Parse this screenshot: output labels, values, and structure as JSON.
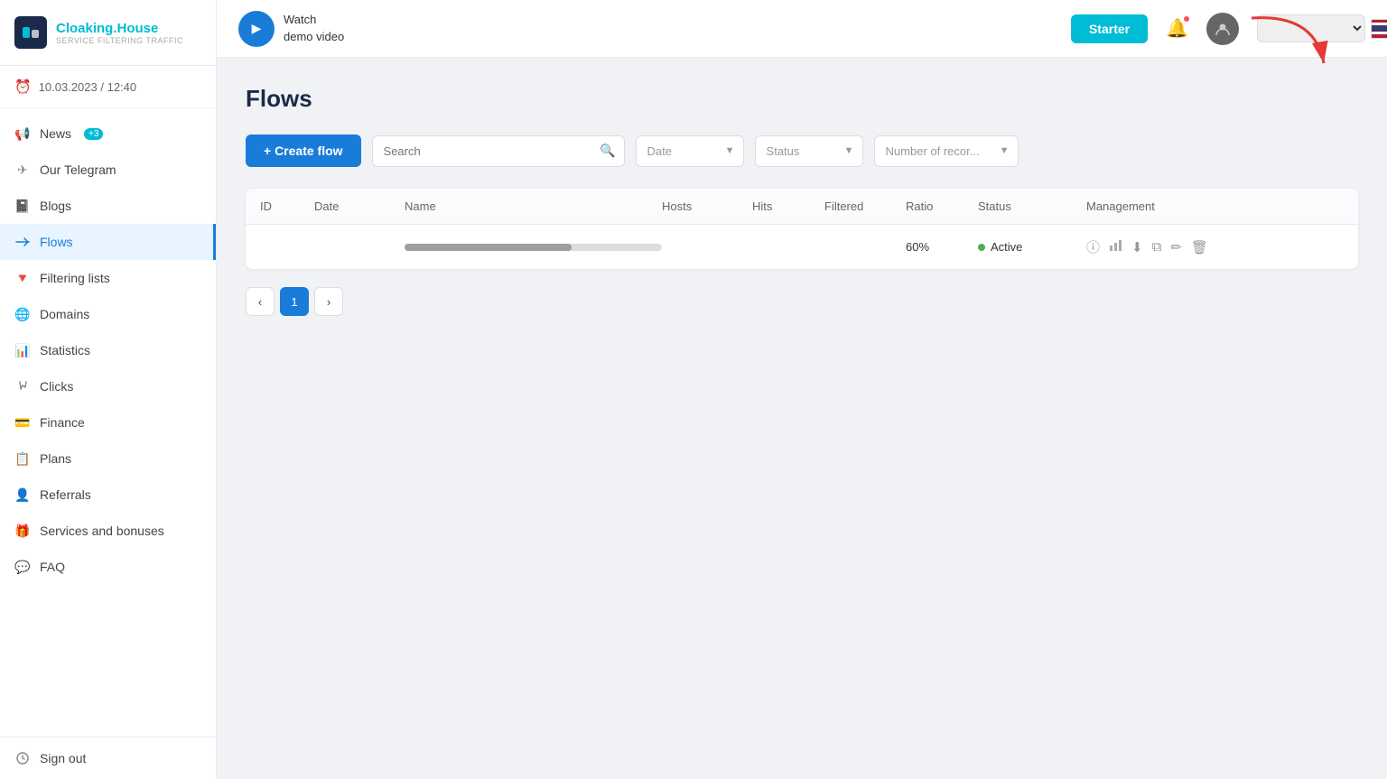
{
  "logo": {
    "icon_text": "C",
    "name": "Cloaking",
    "name_colored": ".House",
    "subtitle": "Service Filtering Traffic"
  },
  "sidebar": {
    "time": "10.03.2023 / 12:40",
    "items": [
      {
        "id": "news",
        "label": "News",
        "badge": "+3",
        "icon": "📢"
      },
      {
        "id": "telegram",
        "label": "Our Telegram",
        "icon": "✈"
      },
      {
        "id": "blogs",
        "label": "Blogs",
        "icon": "📓"
      },
      {
        "id": "flows",
        "label": "Flows",
        "icon": "↔",
        "active": true
      },
      {
        "id": "filtering-lists",
        "label": "Filtering lists",
        "icon": "🔻"
      },
      {
        "id": "domains",
        "label": "Domains",
        "icon": "🌐"
      },
      {
        "id": "statistics",
        "label": "Statistics",
        "icon": "📊"
      },
      {
        "id": "clicks",
        "label": "Clicks",
        "icon": "🖱"
      },
      {
        "id": "finance",
        "label": "Finance",
        "icon": "💳"
      },
      {
        "id": "plans",
        "label": "Plans",
        "icon": "📋"
      },
      {
        "id": "referrals",
        "label": "Referrals",
        "icon": "👤"
      },
      {
        "id": "services-bonuses",
        "label": "Services and bonuses",
        "icon": "🎁"
      },
      {
        "id": "faq",
        "label": "FAQ",
        "icon": "💬"
      }
    ],
    "signout": "Sign out"
  },
  "header": {
    "demo_line1": "Watch",
    "demo_line2": "demo video",
    "starter_label": "Starter"
  },
  "page": {
    "title": "Flows",
    "create_btn": "+ Create flow",
    "search_placeholder": "Search",
    "date_placeholder": "Date",
    "status_placeholder": "Status",
    "records_placeholder": "Number of recor..."
  },
  "table": {
    "columns": [
      "ID",
      "Date",
      "Name",
      "Hosts",
      "Hits",
      "Filtered",
      "Ratio",
      "Status",
      "Management"
    ],
    "rows": [
      {
        "id": "",
        "date": "",
        "name": "",
        "hosts": "",
        "hits": "",
        "filtered": "",
        "ratio": "60%",
        "status": "Active",
        "has_bar": true
      }
    ]
  },
  "pagination": {
    "current": 1,
    "pages": [
      1
    ]
  }
}
